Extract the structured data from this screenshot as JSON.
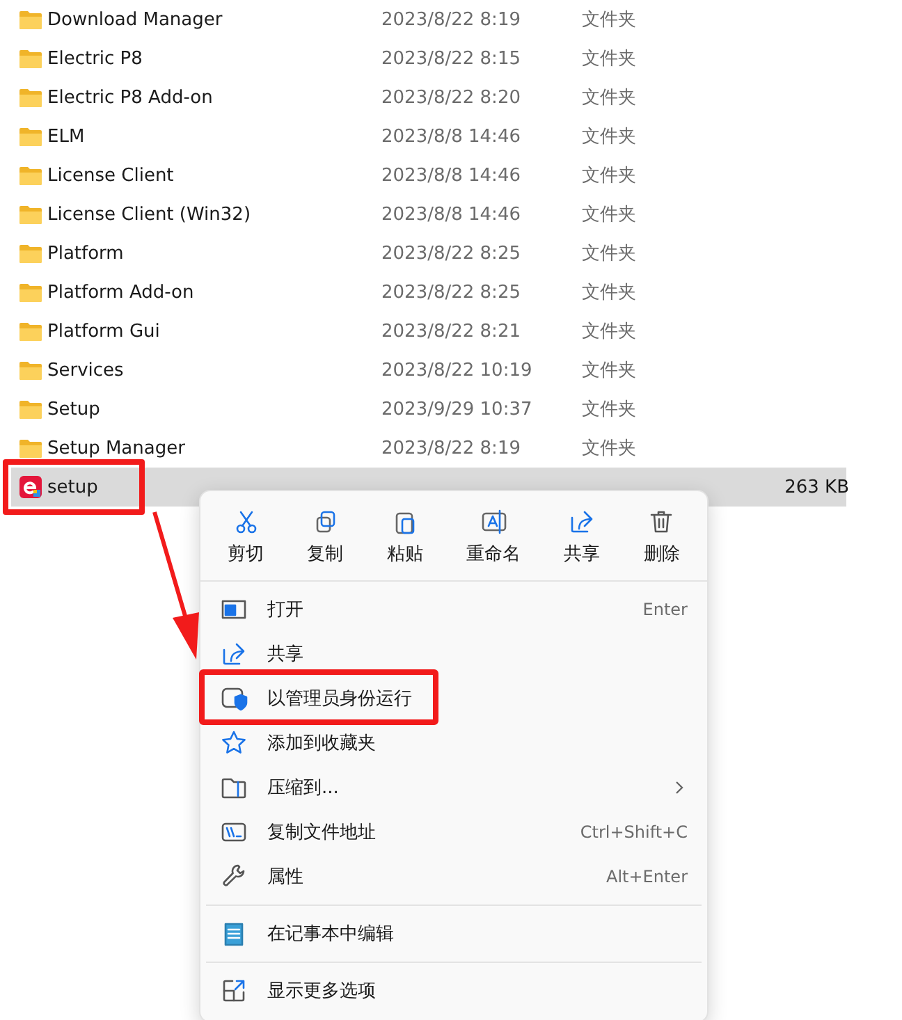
{
  "files": [
    {
      "name": "Download Manager",
      "kind": "folder",
      "date": "2023/8/22 8:19",
      "type": "文件夹",
      "selected": false,
      "highlighted": false
    },
    {
      "name": "Electric P8",
      "kind": "folder",
      "date": "2023/8/22 8:15",
      "type": "文件夹",
      "selected": false,
      "highlighted": false
    },
    {
      "name": "Electric P8 Add-on",
      "kind": "folder",
      "date": "2023/8/22 8:20",
      "type": "文件夹",
      "selected": false,
      "highlighted": false
    },
    {
      "name": "ELM",
      "kind": "folder",
      "date": "2023/8/8 14:46",
      "type": "文件夹",
      "selected": false,
      "highlighted": false
    },
    {
      "name": "License Client",
      "kind": "folder",
      "date": "2023/8/8 14:46",
      "type": "文件夹",
      "selected": false,
      "highlighted": false
    },
    {
      "name": "License Client (Win32)",
      "kind": "folder",
      "date": "2023/8/8 14:46",
      "type": "文件夹",
      "selected": false,
      "highlighted": false
    },
    {
      "name": "Platform",
      "kind": "folder",
      "date": "2023/8/22 8:25",
      "type": "文件夹",
      "selected": false,
      "highlighted": false
    },
    {
      "name": "Platform Add-on",
      "kind": "folder",
      "date": "2023/8/22 8:25",
      "type": "文件夹",
      "selected": false,
      "highlighted": false
    },
    {
      "name": "Platform Gui",
      "kind": "folder",
      "date": "2023/8/22 8:21",
      "type": "文件夹",
      "selected": false,
      "highlighted": false
    },
    {
      "name": "Services",
      "kind": "folder",
      "date": "2023/8/22 10:19",
      "type": "文件夹",
      "selected": false,
      "highlighted": false
    },
    {
      "name": "Setup",
      "kind": "folder",
      "date": "2023/9/29 10:37",
      "type": "文件夹",
      "selected": false,
      "highlighted": false
    },
    {
      "name": "Setup Manager",
      "kind": "folder",
      "date": "2023/8/22 8:19",
      "type": "文件夹",
      "selected": false,
      "highlighted": false
    },
    {
      "name": "setup",
      "kind": "app",
      "size": "263 KB",
      "selected": true,
      "highlighted": true
    }
  ],
  "context_menu": {
    "actions": [
      {
        "label": "剪切"
      },
      {
        "label": "复制"
      },
      {
        "label": "粘贴"
      },
      {
        "label": "重命名"
      },
      {
        "label": "共享"
      },
      {
        "label": "删除"
      }
    ],
    "items": [
      {
        "kind": "item",
        "label": "打开",
        "shortcut": "Enter",
        "highlighted": false
      },
      {
        "kind": "item",
        "label": "共享",
        "highlighted": false
      },
      {
        "kind": "item",
        "label": "以管理员身份运行",
        "highlighted": true
      },
      {
        "kind": "item",
        "label": "添加到收藏夹",
        "highlighted": false
      },
      {
        "kind": "submenu",
        "label": "压缩到...",
        "highlighted": false
      },
      {
        "kind": "item",
        "label": "复制文件地址",
        "shortcut": "Ctrl+Shift+C",
        "highlighted": false
      },
      {
        "kind": "item",
        "label": "属性",
        "shortcut": "Alt+Enter",
        "highlighted": false
      },
      {
        "kind": "separator"
      },
      {
        "kind": "item",
        "label": "在记事本中编辑",
        "highlighted": false
      },
      {
        "kind": "separator"
      },
      {
        "kind": "item",
        "label": "显示更多选项",
        "highlighted": false
      }
    ]
  }
}
